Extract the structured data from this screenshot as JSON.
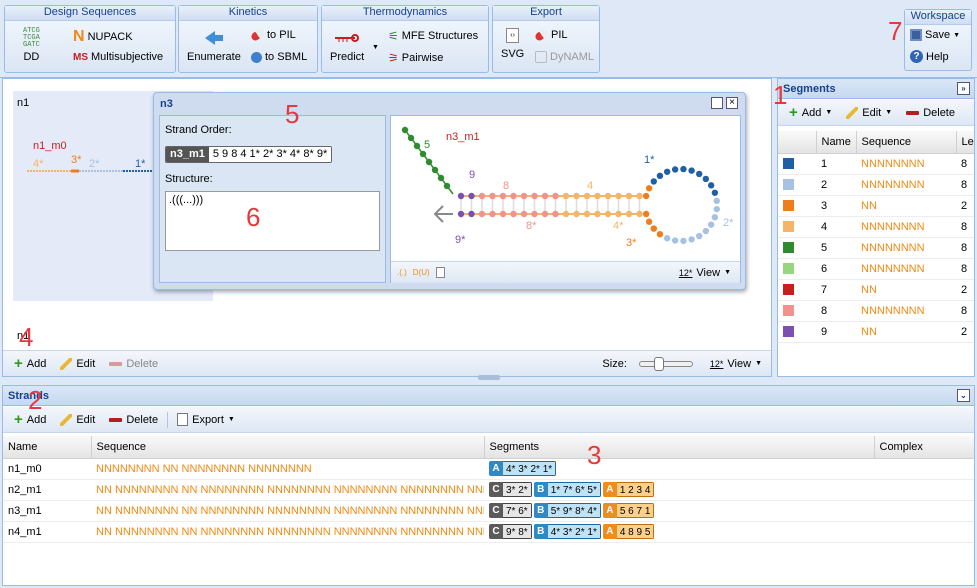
{
  "ribbon": {
    "groups": [
      {
        "title": "Design Sequences"
      },
      {
        "title": "Kinetics"
      },
      {
        "title": "Thermodynamics"
      },
      {
        "title": "Export"
      },
      {
        "title": "Workspace"
      }
    ],
    "dd_icon_text": "ATCG\nTCGA\nGATC",
    "dd": "DD",
    "nupack": "NUPACK",
    "multisubjective": "Multisubjective",
    "enumerate": "Enumerate",
    "to_pil": "to PIL",
    "to_sbml": "to SBML",
    "predict": "Predict",
    "mfe": "MFE Structures",
    "pairwise": "Pairwise",
    "svg": "SVG",
    "pil": "PIL",
    "dynaml": "DyNAML",
    "save": "Save",
    "help": "Help"
  },
  "canvas": {
    "strand_label": "n1",
    "strand_label2": "n1",
    "strand_name": "n1_m0",
    "seg_labels": [
      "4*",
      "3*",
      "2*",
      "1*"
    ],
    "size_label": "Size:",
    "view_label": "View",
    "add": "Add",
    "edit": "Edit",
    "delete": "Delete"
  },
  "dialog": {
    "title": "n3",
    "strand_order_label": "Strand Order:",
    "strand_name": "n3_m1",
    "strand_order": "5 9 8 4 1* 2* 3* 4* 8* 9*",
    "structure_label": "Structure:",
    "structure": ".(((...)))",
    "diagram_title": "n3_m1",
    "diagram_labels": {
      "l5": "5",
      "l9": "9",
      "l8": "8",
      "l4": "4",
      "l1s": "1*",
      "l2s": "2*",
      "l3s": "3*",
      "l4s": "4*",
      "l8s": "8*",
      "l9s": "9*"
    },
    "view": "View",
    "footer_icons": [
      ".(.)",
      "D(U)"
    ]
  },
  "segments": {
    "title": "Segments",
    "add": "Add",
    "edit": "Edit",
    "delete": "Delete",
    "columns": [
      "Name",
      "Sequence",
      "Len"
    ],
    "rows": [
      {
        "color": "#1f5fa6",
        "name": "1",
        "seq": "NNNNNNNN",
        "len": "8"
      },
      {
        "color": "#a7c1e3",
        "name": "2",
        "seq": "NNNNNNNN",
        "len": "8"
      },
      {
        "color": "#ef7d1c",
        "name": "3",
        "seq": "NN",
        "len": "2"
      },
      {
        "color": "#f4b46a",
        "name": "4",
        "seq": "NNNNNNNN",
        "len": "8"
      },
      {
        "color": "#2e8b2e",
        "name": "5",
        "seq": "NNNNNNNN",
        "len": "8"
      },
      {
        "color": "#97d67f",
        "name": "6",
        "seq": "NNNNNNNN",
        "len": "8"
      },
      {
        "color": "#c81e1e",
        "name": "7",
        "seq": "NN",
        "len": "2"
      },
      {
        "color": "#f2918e",
        "name": "8",
        "seq": "NNNNNNNN",
        "len": "8"
      },
      {
        "color": "#7d4fb0",
        "name": "9",
        "seq": "NN",
        "len": "2"
      }
    ]
  },
  "strands": {
    "title": "Strands",
    "add": "Add",
    "edit": "Edit",
    "delete": "Delete",
    "export": "Export",
    "columns": [
      "Name",
      "Sequence",
      "Segments",
      "Complex"
    ],
    "rows": [
      {
        "name": "n1_m0",
        "seq": "NNNNNNNN NN NNNNNNNN NNNNNNNN",
        "chips": [
          {
            "l": "A",
            "t": "4* 3* 2* 1*",
            "c": "blue"
          }
        ]
      },
      {
        "name": "n2_m1",
        "seq": "NN NNNNNNNN NN NNNNNNNN NNNNNNNN NNNNNNNN NNNNNNNN NNNNN...",
        "chips": [
          {
            "l": "C",
            "t": "3* 2*",
            "c": "gray"
          },
          {
            "l": "B",
            "t": "1* 7* 6* 5*",
            "c": "blue"
          },
          {
            "l": "A",
            "t": "1 2 3 4",
            "c": "orange"
          }
        ]
      },
      {
        "name": "n3_m1",
        "seq": "NN NNNNNNNN NN NNNNNNNN NNNNNNNN NNNNNNNN NNNNNNNN NNNNN...",
        "chips": [
          {
            "l": "C",
            "t": "7* 6*",
            "c": "gray"
          },
          {
            "l": "B",
            "t": "5* 9* 8* 4*",
            "c": "blue"
          },
          {
            "l": "A",
            "t": "5 6 7 1",
            "c": "orange"
          }
        ]
      },
      {
        "name": "n4_m1",
        "seq": "NN NNNNNNNN NN NNNNNNNN NNNNNNNN NNNNNNNN NNNNNNNN NNNNN...",
        "chips": [
          {
            "l": "C",
            "t": "9* 8*",
            "c": "gray"
          },
          {
            "l": "B",
            "t": "4* 3* 2* 1*",
            "c": "blue"
          },
          {
            "l": "A",
            "t": "4 8 9 5",
            "c": "orange"
          }
        ]
      }
    ]
  },
  "annotations": {
    "n1": "1",
    "n2": "2",
    "n3": "3",
    "n4": "4",
    "n5": "5",
    "n6": "6",
    "n7": "7"
  }
}
